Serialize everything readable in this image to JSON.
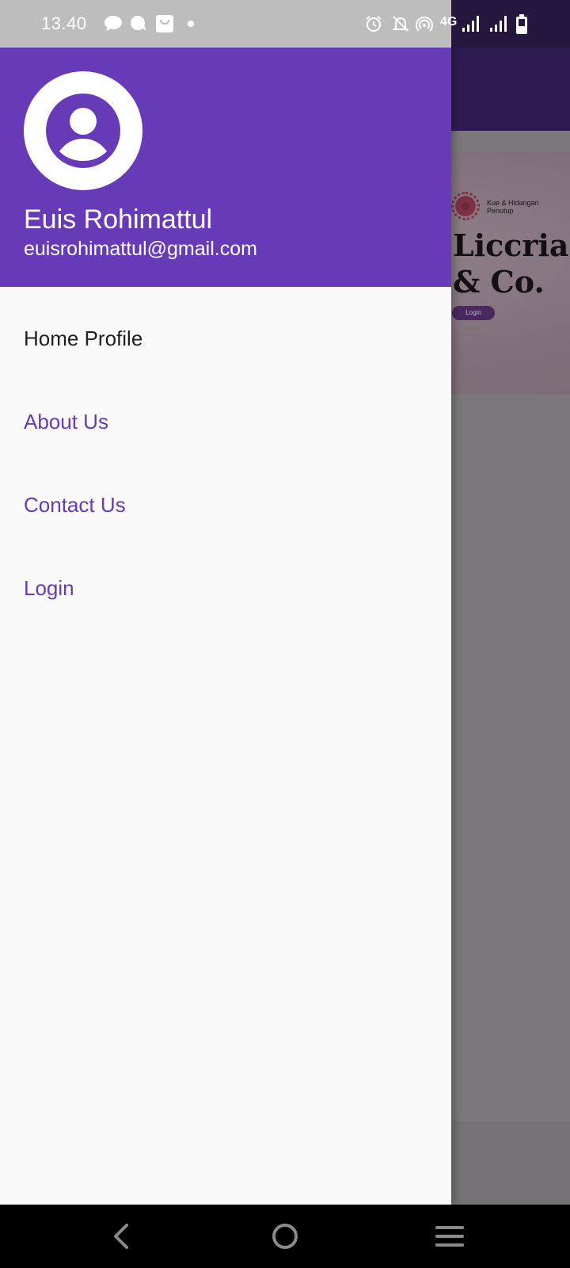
{
  "status_bar": {
    "time": "13.40",
    "network_type": "4G",
    "icons": [
      "chat-bubble-icon",
      "message-icon",
      "shopping-bag-icon",
      "dot-icon",
      "alarm-icon",
      "bell-off-icon",
      "hotspot-icon",
      "signal-icon",
      "signal-icon",
      "battery-icon"
    ]
  },
  "drawer": {
    "header": {
      "avatar_icon": "account-circle-icon",
      "name": "Euis Rohimattul",
      "email": "euisrohimattul@gmail.com",
      "background_color": "#673ab7"
    },
    "menu": [
      {
        "label": "Home Profile"
      },
      {
        "label": "About Us"
      },
      {
        "label": "Contact Us"
      },
      {
        "label": "Login"
      }
    ],
    "accent_color": "#673ab7"
  },
  "background_app": {
    "tagline_line1": "Kue & Hidangan",
    "tagline_line2": "Penutup",
    "brand_line1": "Liccria",
    "brand_line2": "& Co.",
    "login_button": "Login"
  },
  "nav_bar": {
    "icons": [
      "back-icon",
      "home-icon",
      "recents-icon"
    ]
  }
}
